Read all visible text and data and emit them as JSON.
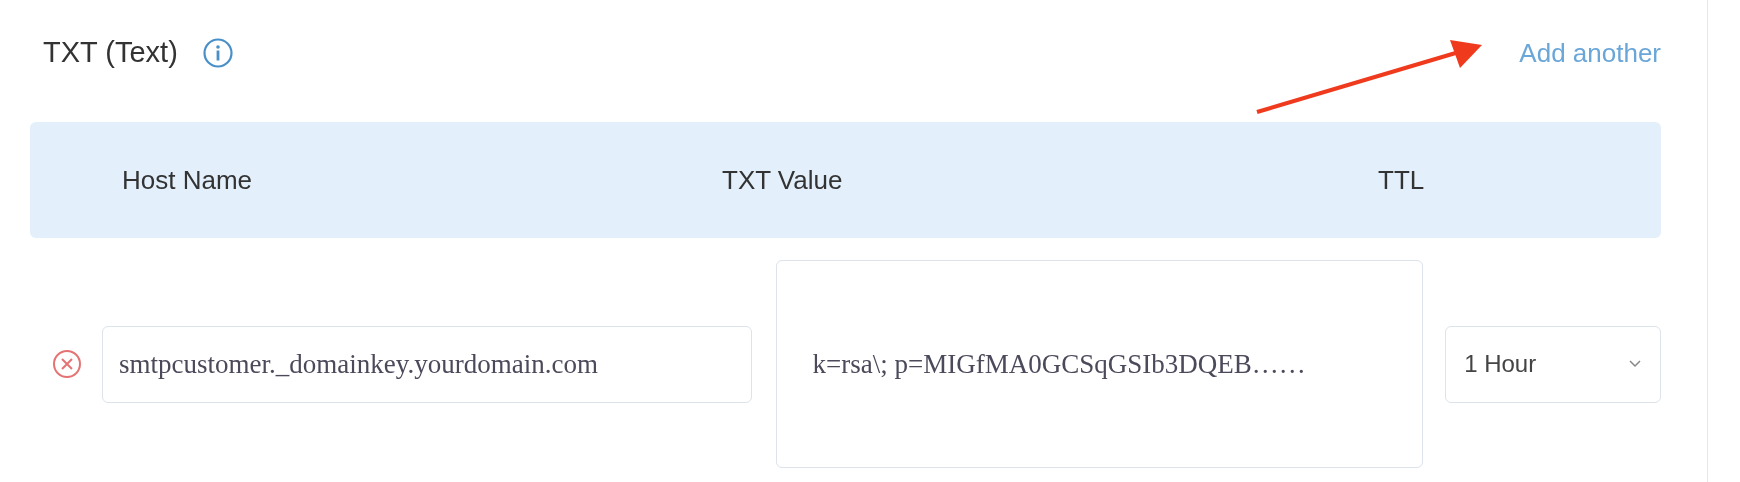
{
  "section": {
    "title": "TXT (Text)",
    "add_link": "Add another"
  },
  "table": {
    "columns": [
      "Host Name",
      "TXT Value",
      "TTL"
    ],
    "rows": [
      {
        "host_name": "smtpcustomer._domainkey.yourdomain.com",
        "txt_value": "k=rsa\\; p=MIGfMA0GCSqGSIb3DQEB……",
        "ttl": "1 Hour"
      }
    ]
  }
}
